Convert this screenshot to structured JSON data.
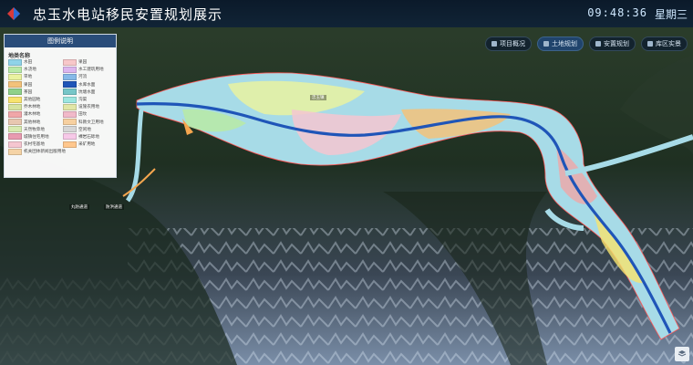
{
  "header": {
    "title": "忠玉水电站移民安置规划展示",
    "time": "09:48:36",
    "weekday": "星期三"
  },
  "tabs": [
    {
      "label": "项目概况",
      "icon": "info-icon",
      "active": false
    },
    {
      "label": "土地规划",
      "icon": "layers-icon",
      "active": true
    },
    {
      "label": "安置规划",
      "icon": "grid-icon",
      "active": false
    },
    {
      "label": "库区实景",
      "icon": "mountain-icon",
      "active": false
    }
  ],
  "legend": {
    "tab_label": "图例说明",
    "heading": "地类名称",
    "col1": [
      {
        "label": "水田",
        "color": "#8fd3e8"
      },
      {
        "label": "水浇地",
        "color": "#b8e9a8"
      },
      {
        "label": "旱地",
        "color": "#e9f2a0"
      },
      {
        "label": "果园",
        "color": "#f3c27a"
      },
      {
        "label": "茶园",
        "color": "#8fd18a"
      },
      {
        "label": "其他园地",
        "color": "#f7e36e"
      },
      {
        "label": "乔木林地",
        "color": "#d6e3a0"
      },
      {
        "label": "灌木林地",
        "color": "#f0a6a8"
      },
      {
        "label": "其他林地",
        "color": "#e8c7b0"
      },
      {
        "label": "天然牧草地",
        "color": "#d8eab0"
      },
      {
        "label": "城镇住宅用地",
        "color": "#e89ab0"
      },
      {
        "label": "农村宅基地",
        "color": "#f5c6d0"
      },
      {
        "label": "机关团体新闻出版用地",
        "color": "#f5d3a6"
      }
    ],
    "col2": [
      {
        "label": "果园",
        "color": "#f7c7c9"
      },
      {
        "label": "水工建筑用地",
        "color": "#dcb6ee"
      },
      {
        "label": "河流",
        "color": "#86b9e8"
      },
      {
        "label": "水库水面",
        "color": "#1f55b8"
      },
      {
        "label": "坑塘水面",
        "color": "#76c6c8"
      },
      {
        "label": "沟渠",
        "color": "#9ce6e0"
      },
      {
        "label": "设施农用地",
        "color": "#e1e6a6"
      },
      {
        "label": "田坎",
        "color": "#f1b9c9"
      },
      {
        "label": "科教文卫用地",
        "color": "#f7d0a0"
      },
      {
        "label": "空闲地",
        "color": "#d6d6d6"
      },
      {
        "label": "裸岩石砾地",
        "color": "#f7c9e8"
      },
      {
        "label": "采矿用地",
        "color": "#ffc78d"
      }
    ]
  },
  "map_labels": {
    "left_low_1": "丸防通道",
    "left_low_2": "防洪通道",
    "place_1": "忠玉镇"
  },
  "colors": {
    "header_bg": "#0b1a2a",
    "river": "#1f55b8",
    "corridor": "#a7dbe7"
  }
}
